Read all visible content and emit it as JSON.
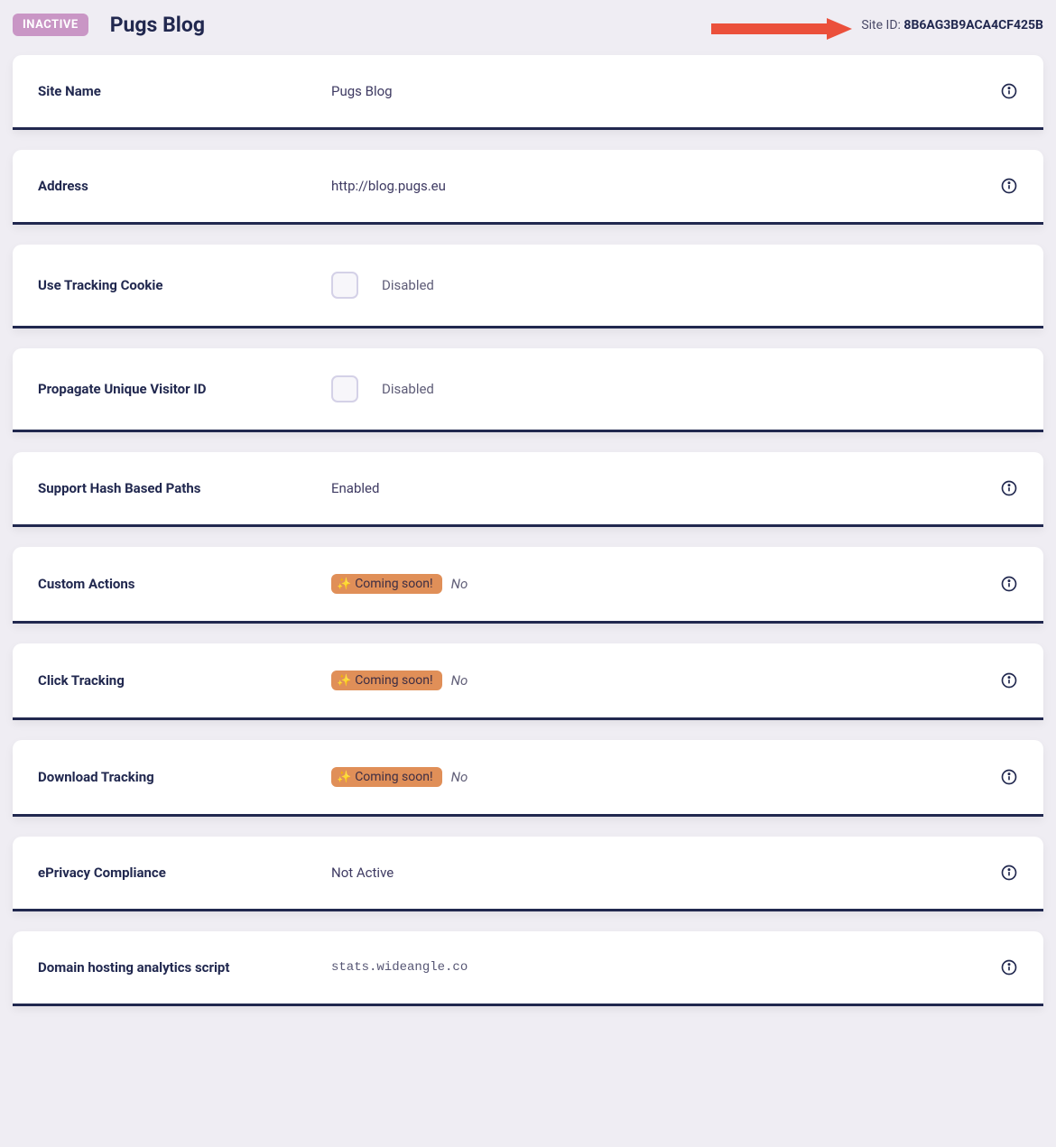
{
  "header": {
    "badge": "INACTIVE",
    "title": "Pugs Blog",
    "site_id_label": "Site ID: ",
    "site_id_value": "8B6AG3B9ACA4CF425B"
  },
  "rows": {
    "site_name": {
      "label": "Site Name",
      "value": "Pugs Blog"
    },
    "address": {
      "label": "Address",
      "value": "http://blog.pugs.eu"
    },
    "use_tracking_cookie": {
      "label": "Use Tracking Cookie",
      "status": "Disabled"
    },
    "propagate_uid": {
      "label": "Propagate Unique Visitor ID",
      "status": "Disabled"
    },
    "support_hash": {
      "label": "Support Hash Based Paths",
      "value": "Enabled"
    },
    "custom_actions": {
      "label": "Custom Actions",
      "badge": "Coming soon!",
      "value": "No"
    },
    "click_tracking": {
      "label": "Click Tracking",
      "badge": "Coming soon!",
      "value": "No"
    },
    "download_tracking": {
      "label": "Download Tracking",
      "badge": "Coming soon!",
      "value": "No"
    },
    "eprivacy": {
      "label": "ePrivacy Compliance",
      "value": "Not Active"
    },
    "domain_script": {
      "label": "Domain hosting analytics script",
      "value": "stats.wideangle.co"
    }
  }
}
